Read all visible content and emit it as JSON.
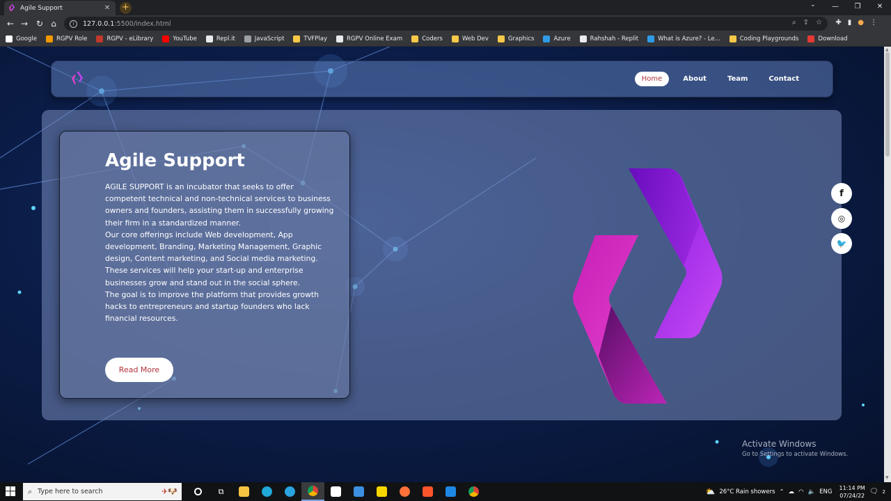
{
  "browser": {
    "tab_title": "Agile Support",
    "tab_close": "✕",
    "new_tab": "+",
    "url_host": "127.0.0.1",
    "url_path": ":5500/index.html",
    "bookmarks": [
      {
        "label": "Google",
        "color": "#ffffff"
      },
      {
        "label": "RGPV Role",
        "color": "#f29900"
      },
      {
        "label": "RGPV - eLibrary",
        "color": "#c0392b"
      },
      {
        "label": "YouTube",
        "color": "#ff0000"
      },
      {
        "label": "Repl.it",
        "color": "#e8eaed"
      },
      {
        "label": "JavaScript",
        "color": "#9aa0a6"
      },
      {
        "label": "TVFPlay",
        "color": "#f7c948"
      },
      {
        "label": "RGPV Online Exam",
        "color": "#e8eaed"
      },
      {
        "label": "Coders",
        "color": "#f7c948"
      },
      {
        "label": "Web Dev",
        "color": "#f7c948"
      },
      {
        "label": "Graphics",
        "color": "#f7c948"
      },
      {
        "label": "Azure",
        "color": "#2f9be6"
      },
      {
        "label": "Rahshah - Replit",
        "color": "#e8eaed"
      },
      {
        "label": "What is Azure? - Le...",
        "color": "#2f9be6"
      },
      {
        "label": "Coding Playgrounds",
        "color": "#f7c948"
      },
      {
        "label": "Download",
        "color": "#e53935"
      }
    ]
  },
  "site": {
    "nav": [
      {
        "label": "Home",
        "active": true
      },
      {
        "label": "About",
        "active": false
      },
      {
        "label": "Team",
        "active": false
      },
      {
        "label": "Contact",
        "active": false
      }
    ],
    "hero": {
      "title": "Agile Support",
      "paragraphs": [
        "AGILE SUPPORT is an incubator that seeks to offer competent technical and non-technical services to business owners and founders, assisting them in successfully growing their firm in a standardized manner.",
        "Our core offerings include Web development, App development, Branding, Marketing Management, Graphic design, Content marketing, and Social media marketing. These services will help your start-up and enterprise businesses grow and stand out in the social sphere.",
        "The goal is to improve the platform that provides growth hacks to entrepreneurs and startup founders who lack financial resources."
      ],
      "button": "Read More"
    },
    "socials": [
      {
        "name": "facebook-icon",
        "glyph": "f"
      },
      {
        "name": "instagram-icon",
        "glyph": "◎"
      },
      {
        "name": "twitter-icon",
        "glyph": "🐦"
      }
    ],
    "colors": {
      "accent": "#b0323a",
      "logo_light": "#c043f0",
      "logo_dark": "#6a0dad",
      "logo_pink": "#e040c8"
    }
  },
  "watermark": {
    "title": "Activate Windows",
    "subtitle": "Go to Settings to activate Windows."
  },
  "taskbar": {
    "search_placeholder": "Type here to search",
    "weather": "26°C  Rain showers",
    "language": "ENG",
    "time": "11:14 PM",
    "date": "07/24/22",
    "notifications": "2"
  }
}
